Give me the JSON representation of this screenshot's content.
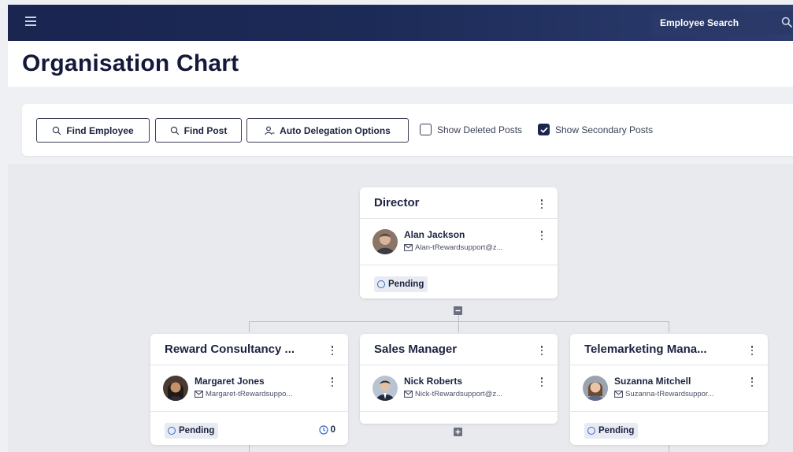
{
  "header": {
    "search_placeholder": "Employee Search"
  },
  "page": {
    "title": "Organisation Chart"
  },
  "toolbar": {
    "find_employee": "Find Employee",
    "find_post": "Find Post",
    "auto_delegation": "Auto Delegation Options",
    "show_deleted_posts": "Show Deleted Posts",
    "show_deleted_checked": false,
    "show_secondary_posts": "Show Secondary Posts",
    "show_secondary_checked": true
  },
  "colors": {
    "brand_navy": "#1a2550",
    "pending_ring": "#3a66c9",
    "canvas": "#e9eaed"
  },
  "chart": {
    "director": {
      "post": "Director",
      "employee": "Alan Jackson",
      "email": "Alan-tRewardsupport@z...",
      "status": "Pending"
    },
    "reports": [
      {
        "post": "Reward Consultancy ...",
        "employee": "Margaret Jones",
        "email": "Margaret-tRewardsuppo...",
        "status": "Pending",
        "count": "0"
      },
      {
        "post": "Sales Manager",
        "employee": "Nick Roberts",
        "email": "Nick-tRewardsupport@z...",
        "status": ""
      },
      {
        "post": "Telemarketing Mana...",
        "employee": "Suzanna Mitchell",
        "email": "Suzanna-tRewardsuppor...",
        "status": "Pending"
      }
    ]
  }
}
